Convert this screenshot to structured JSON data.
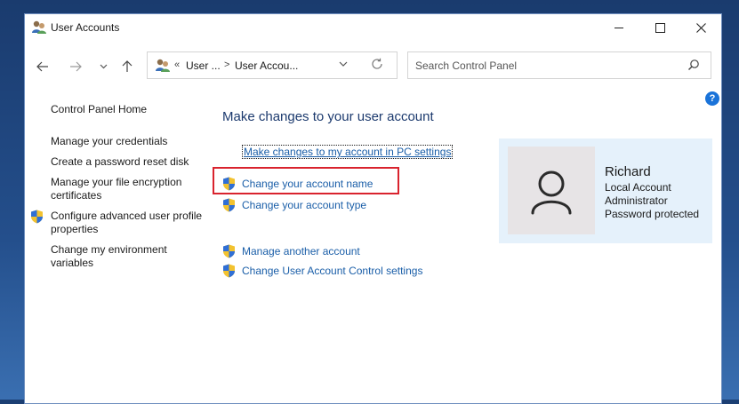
{
  "window": {
    "title": "User Accounts",
    "minimize_icon": "minimize-icon",
    "maximize_icon": "maximize-icon",
    "close_icon": "close-icon"
  },
  "navigation": {
    "back_icon": "arrow-left-icon",
    "forward_icon": "arrow-right-icon",
    "recent_icon": "chevron-down-icon",
    "up_icon": "arrow-up-icon",
    "address": {
      "prefix": "«",
      "crumbs": [
        "User ...",
        "User Accou..."
      ],
      "separator": ">",
      "refresh_icon": "refresh-icon"
    },
    "search": {
      "placeholder": "Search Control Panel",
      "value": ""
    }
  },
  "help_label": "?",
  "left_nav": {
    "home": "Control Panel Home",
    "items": [
      {
        "label": "Manage your credentials",
        "shield": false
      },
      {
        "label": "Create a password reset disk",
        "shield": false
      },
      {
        "label": "Manage your file encryption certificates",
        "shield": false
      },
      {
        "label": "Configure advanced user profile properties",
        "shield": true
      },
      {
        "label": "Change my environment variables",
        "shield": false
      }
    ]
  },
  "main": {
    "title": "Make changes to your user account",
    "pc_settings_link": "Make changes to my account in PC settings",
    "links_group1": [
      {
        "label": "Change your account name",
        "shield": true,
        "highlighted": true
      },
      {
        "label": "Change your account type",
        "shield": true
      }
    ],
    "links_group2": [
      {
        "label": "Manage another account",
        "shield": true
      },
      {
        "label": "Change User Account Control settings",
        "shield": true
      }
    ]
  },
  "account": {
    "name": "Richard",
    "type": "Local Account",
    "role": "Administrator",
    "status": "Password protected"
  },
  "colors": {
    "link": "#1a5ea8",
    "title": "#1c3a6e",
    "highlight": "#d9232e",
    "card_bg": "#e5f1fb"
  }
}
